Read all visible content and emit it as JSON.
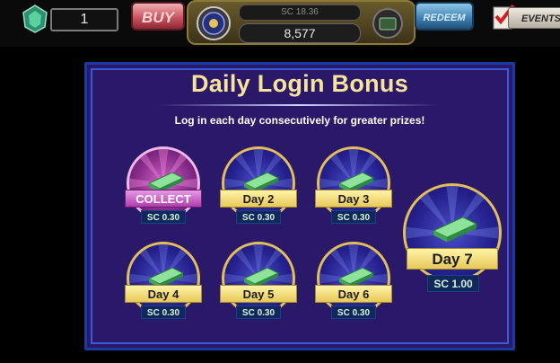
{
  "topbar": {
    "level": "1",
    "buy_label": "BUY",
    "sc_balance": "SC 18.36",
    "gc_balance": "8,577",
    "redeem_label": "REDEEM",
    "events_label": "EVENTS"
  },
  "panel": {
    "title": "Daily Login Bonus",
    "subtitle": "Log in each day consecutively for greater prizes!",
    "days": [
      {
        "label": "COLLECT",
        "prize": "SC 0.30"
      },
      {
        "label": "Day 2",
        "prize": "SC 0.30"
      },
      {
        "label": "Day 3",
        "prize": "SC 0.30"
      },
      {
        "label": "Day 4",
        "prize": "SC 0.30"
      },
      {
        "label": "Day 5",
        "prize": "SC 0.30"
      },
      {
        "label": "Day 6",
        "prize": "SC 0.30"
      },
      {
        "label": "Day 7",
        "prize": "SC 1.00"
      }
    ]
  },
  "colors": {
    "panel_bg": "#2a1868",
    "title_gold": "#f7e39c",
    "ribbon_gold": "#e8c95a",
    "collect_purple": "#b03db0"
  }
}
